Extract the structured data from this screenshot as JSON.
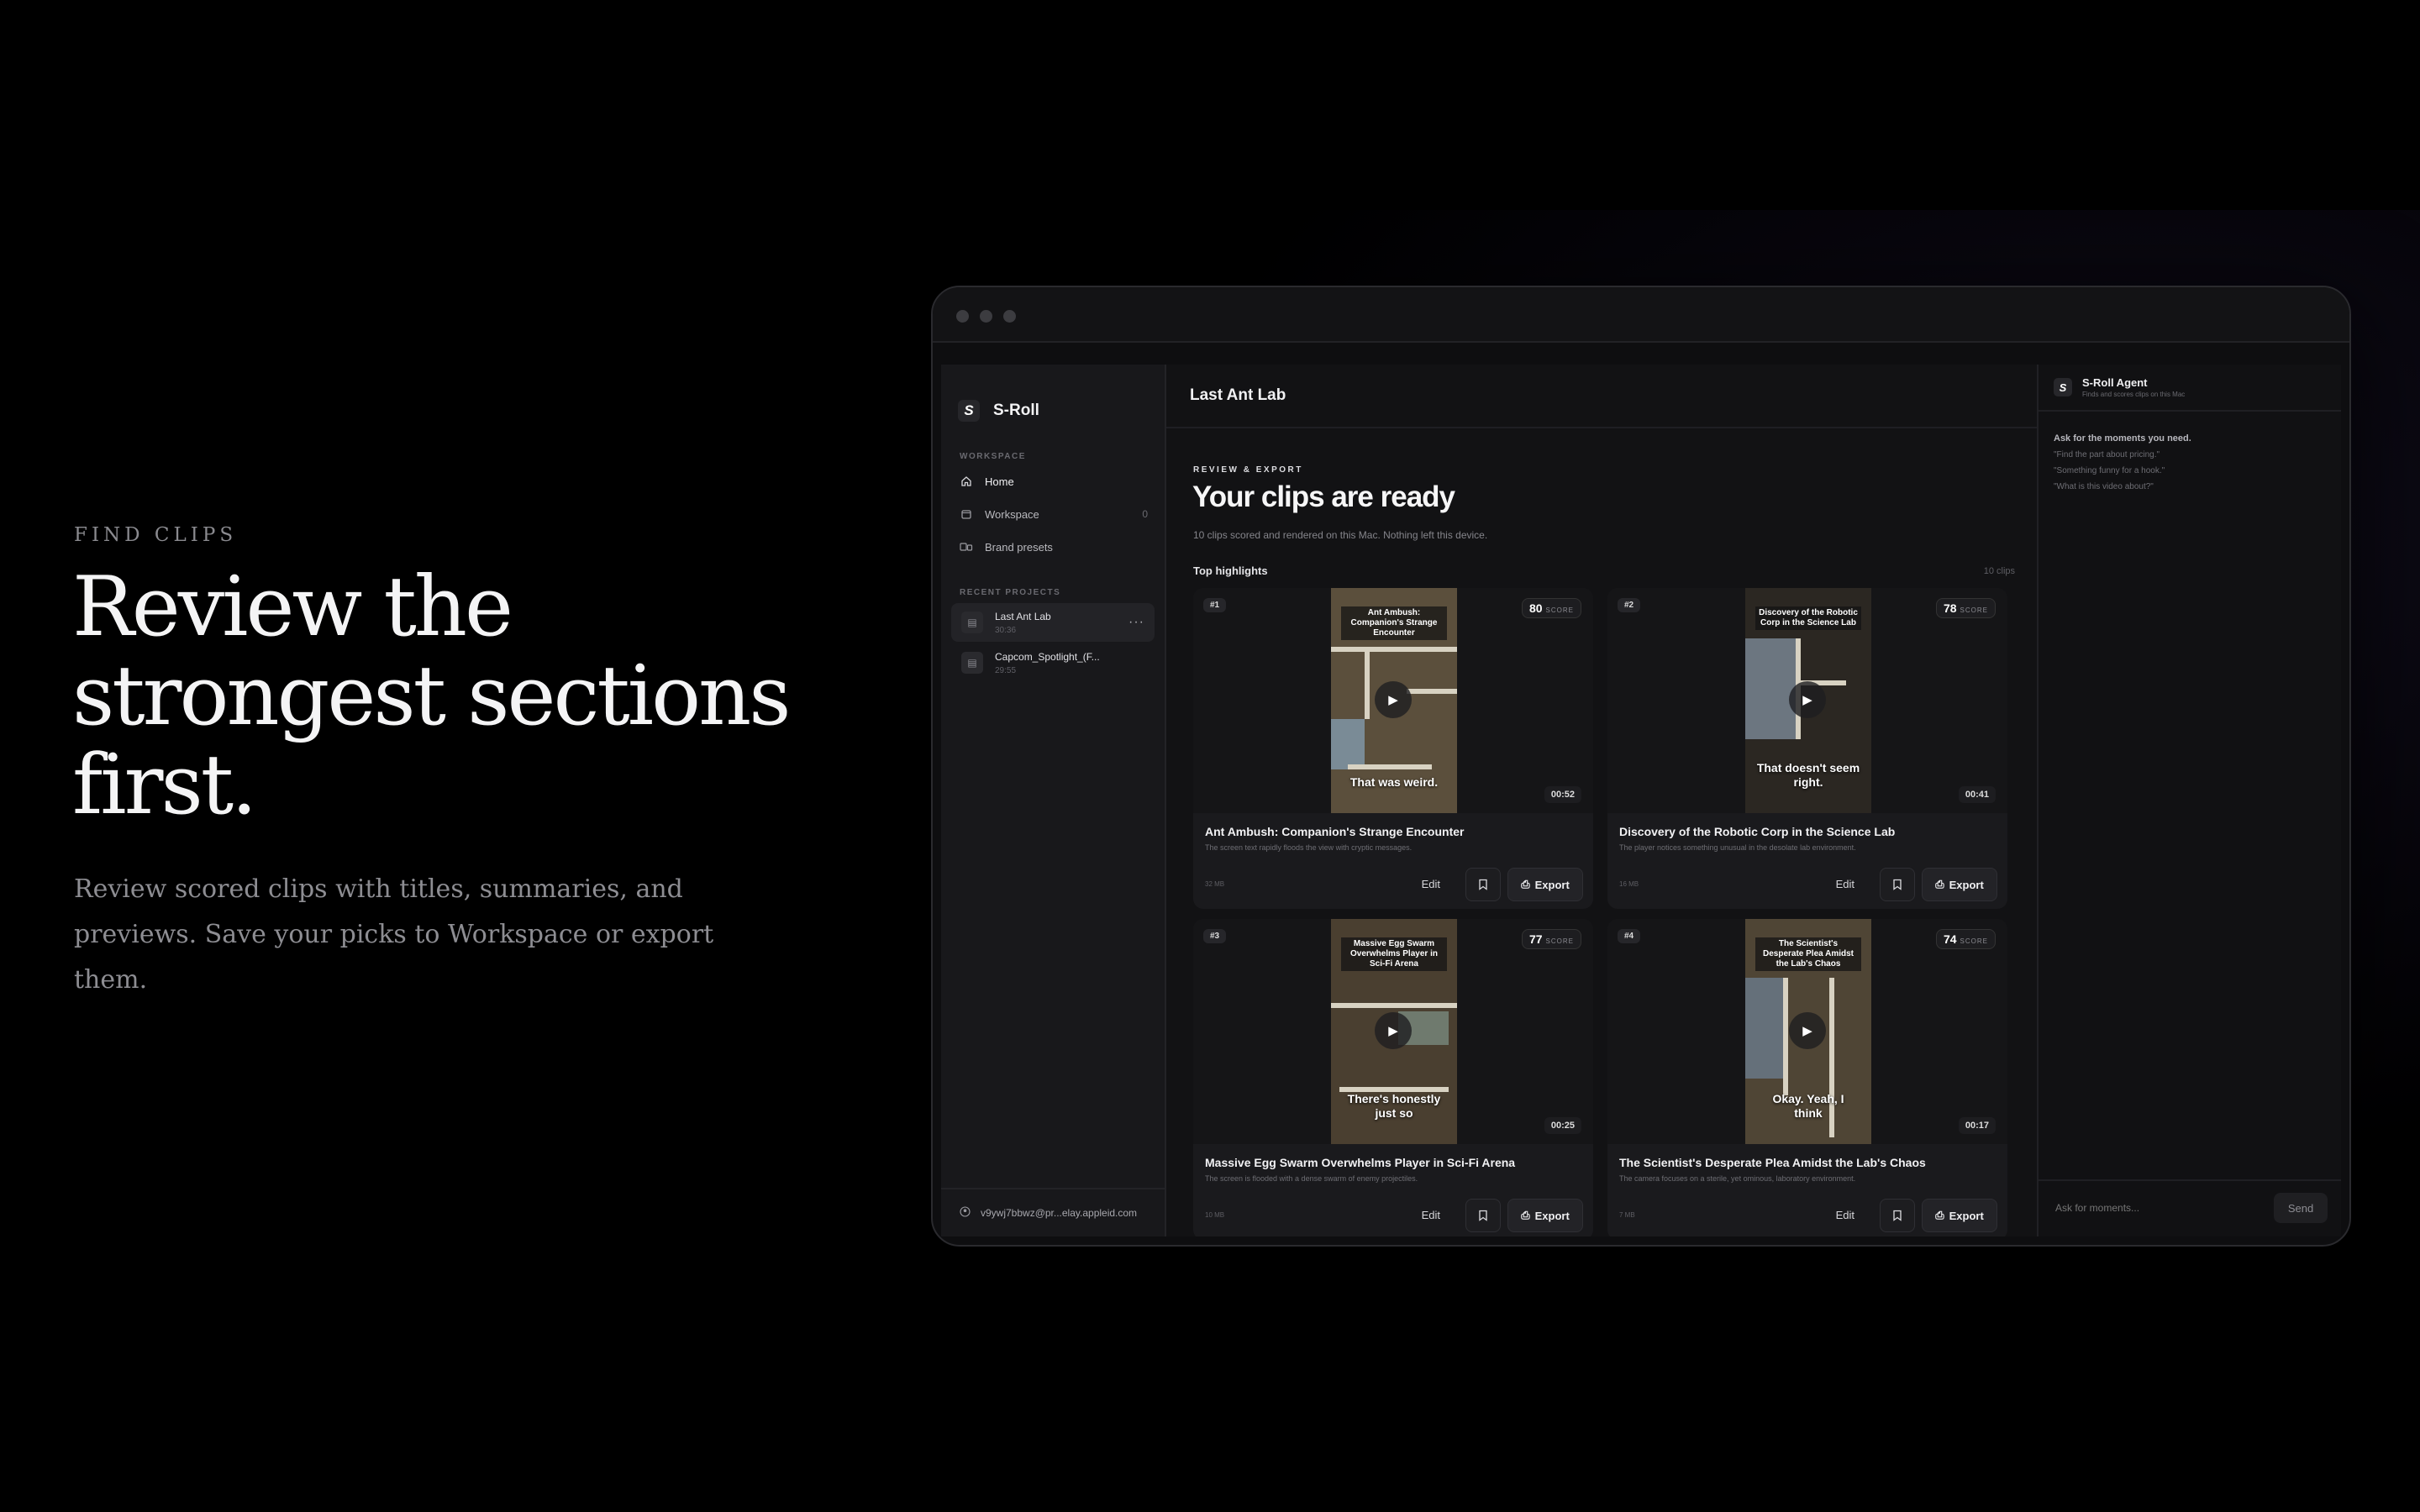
{
  "marketing": {
    "eyebrow": "FIND CLIPS",
    "headline": "Review the strongest sections first.",
    "body": "Review scored clips with titles, summaries, and previews. Save your picks to Workspace or export them."
  },
  "sidebar": {
    "app_name": "S-Roll",
    "logo_glyph": "S",
    "workspace_label": "WORKSPACE",
    "nav": [
      {
        "label": "Home",
        "icon": "home-icon"
      },
      {
        "label": "Workspace",
        "icon": "folder-icon",
        "count": "0"
      },
      {
        "label": "Brand presets",
        "icon": "presets-icon"
      }
    ],
    "recent_label": "RECENT PROJECTS",
    "projects": [
      {
        "name": "Last Ant Lab",
        "time": "30:36",
        "active": true
      },
      {
        "name": "Capcom_Spotlight_(F...",
        "time": "29:55"
      }
    ],
    "user": "v9ywj7bbwz@pr...elay.appleid.com"
  },
  "main": {
    "project_title": "Last Ant Lab",
    "eyebrow": "REVIEW & EXPORT",
    "title": "Your clips are ready",
    "subtitle": "10 clips scored and rendered on this Mac. Nothing left this device.",
    "section": "Top highlights",
    "clip_count": "10 clips",
    "score_label": "SCORE",
    "edit_label": "Edit",
    "export_label": "Export",
    "clips": [
      {
        "rank": "#1",
        "score": "80",
        "duration": "00:52",
        "caption": "Ant Ambush: Companion's Strange Encounter",
        "subtitle": "That was weird.",
        "title": "Ant Ambush: Companion's Strange Encounter",
        "desc": "The screen text rapidly floods the view with cryptic messages.",
        "size": "32 MB"
      },
      {
        "rank": "#2",
        "score": "78",
        "duration": "00:41",
        "caption": "Discovery of the Robotic Corp in the Science Lab",
        "subtitle": "That doesn't seem right.",
        "title": "Discovery of the Robotic Corp in the Science Lab",
        "desc": "The player notices something unusual in the desolate lab environment.",
        "size": "16 MB"
      },
      {
        "rank": "#3",
        "score": "77",
        "duration": "00:25",
        "caption": "Massive Egg Swarm Overwhelms Player in Sci-Fi Arena",
        "subtitle": "There's honestly just so",
        "title": "Massive Egg Swarm Overwhelms Player in Sci-Fi Arena",
        "desc": "The screen is flooded with a dense swarm of enemy projectiles.",
        "size": "10 MB"
      },
      {
        "rank": "#4",
        "score": "74",
        "duration": "00:17",
        "caption": "The Scientist's Desperate Plea Amidst the Lab's Chaos",
        "subtitle": "Okay. Yeah, I think",
        "title": "The Scientist's Desperate Plea Amidst the Lab's Chaos",
        "desc": "The camera focuses on a sterile, yet ominous, laboratory environment.",
        "size": "7 MB"
      }
    ]
  },
  "agent": {
    "name": "S-Roll Agent",
    "tagline": "Finds and scores clips on this Mac",
    "intro": "Ask for the moments you need.",
    "examples": [
      "\"Find the part about pricing.\"",
      "\"Something funny for a hook.\"",
      "\"What is this video about?\""
    ],
    "input_placeholder": "Ask for moments...",
    "send_label": "Send"
  },
  "colors": {
    "background": "#000000",
    "window": "#0e0e10",
    "sidebar": "#18181b",
    "card": "#1a1a1d"
  }
}
